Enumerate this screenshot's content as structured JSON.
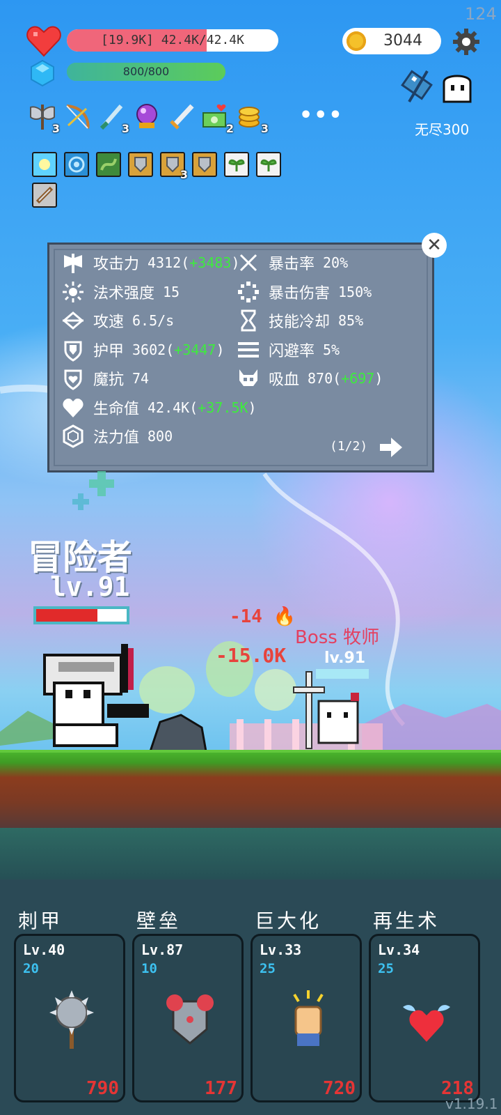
{
  "status": {
    "fps": "124",
    "hp_text": "[19.9K] 42.4K/42.4K",
    "hp_fill_fraction": 0.66,
    "mp_text": "800/800",
    "mp_fill_fraction": 1.0,
    "gold": "3044",
    "mode_label": "无尽300"
  },
  "items": [
    {
      "icon": "battle-axe-icon",
      "count": "3"
    },
    {
      "icon": "bow-icon",
      "count": ""
    },
    {
      "icon": "dagger-icon",
      "count": "3"
    },
    {
      "icon": "crystal-ball-icon",
      "count": ""
    },
    {
      "icon": "sword-icon",
      "count": ""
    },
    {
      "icon": "money-heart-icon",
      "count": "2"
    },
    {
      "icon": "coin-stack-icon",
      "count": "3"
    }
  ],
  "more_label": "•••",
  "relics": [
    {
      "icon": "light-relic-icon",
      "count": "",
      "color": "#5fd2ff"
    },
    {
      "icon": "ice-relic-icon",
      "count": "",
      "color": "#2a8fd6"
    },
    {
      "icon": "vine-relic-icon",
      "count": "",
      "color": "#3f8a3a"
    },
    {
      "icon": "shield-relic-icon",
      "count": "",
      "color": "#d9a23a"
    },
    {
      "icon": "shield-relic-icon",
      "count": "3",
      "color": "#d9a23a"
    },
    {
      "icon": "shield-relic-icon",
      "count": "",
      "color": "#d9a23a"
    },
    {
      "icon": "sprout-relic-icon",
      "count": "",
      "color": "#f3f3f3"
    },
    {
      "icon": "sprout-relic-icon",
      "count": "",
      "color": "#f3f3f3"
    },
    {
      "icon": "blade-relic-icon",
      "count": "",
      "color": "#c7c7c7"
    }
  ],
  "stats": {
    "close": "✕",
    "left": [
      {
        "icon": "attack-icon",
        "label": "攻击力",
        "value": "4312",
        "bonus": "+3483",
        "open": "(",
        "close": ")"
      },
      {
        "icon": "spell-power-icon",
        "label": "法术强度",
        "value": "15",
        "bonus": "",
        "open": "",
        "close": ""
      },
      {
        "icon": "attack-speed-icon",
        "label": "攻速",
        "value": "6.5/s",
        "bonus": "",
        "open": "",
        "close": ""
      },
      {
        "icon": "armor-icon",
        "label": "护甲",
        "value": "3602",
        "bonus": "+3447",
        "open": "(",
        "close": ")"
      },
      {
        "icon": "magic-resist-icon",
        "label": "魔抗",
        "value": "74",
        "bonus": "",
        "open": "",
        "close": ""
      },
      {
        "icon": "health-icon",
        "label": "生命值",
        "value": "42.4K",
        "bonus": "+37.5K",
        "open": "(",
        "close": ")"
      },
      {
        "icon": "mana-icon",
        "label": "法力值",
        "value": "800",
        "bonus": "",
        "open": "",
        "close": ""
      }
    ],
    "right": [
      {
        "icon": "crit-rate-icon",
        "label": "暴击率",
        "value": "20%",
        "bonus": "",
        "open": "",
        "close": ""
      },
      {
        "icon": "crit-damage-icon",
        "label": "暴击伤害",
        "value": "150%",
        "bonus": "",
        "open": "",
        "close": ""
      },
      {
        "icon": "cooldown-icon",
        "label": "技能冷却",
        "value": "85%",
        "bonus": "",
        "open": "",
        "close": ""
      },
      {
        "icon": "dodge-icon",
        "label": "闪避率",
        "value": "5%",
        "bonus": "",
        "open": "",
        "close": ""
      },
      {
        "icon": "lifesteal-icon",
        "label": "吸血",
        "value": "870",
        "bonus": "+697",
        "open": "(",
        "close": ")"
      }
    ],
    "page": "(1/2)"
  },
  "battle": {
    "hero_name": "冒险者",
    "hero_level": "lv.91",
    "hero_hp_fraction": 0.68,
    "damage_fire": "-14",
    "damage_big": "-15.0K",
    "boss_name": "Boss 牧师",
    "boss_level": "lv.91"
  },
  "skills": [
    {
      "title": "刺甲",
      "level": "Lv.40",
      "cost": "20",
      "price": "790",
      "icon": "spiked-mace-icon"
    },
    {
      "title": "壁垒",
      "level": "Lv.87",
      "cost": "10",
      "price": "177",
      "icon": "chest-armor-icon"
    },
    {
      "title": "巨大化",
      "level": "Lv.33",
      "cost": "25",
      "price": "720",
      "icon": "fist-icon"
    },
    {
      "title": "再生术",
      "level": "Lv.34",
      "cost": "25",
      "price": "218",
      "icon": "winged-heart-icon"
    }
  ],
  "version": "v1.19.1",
  "colors": {
    "hp": "#f0667a",
    "bonus": "#3dec3d",
    "price": "#e53535",
    "cost": "#3dc1f0"
  }
}
